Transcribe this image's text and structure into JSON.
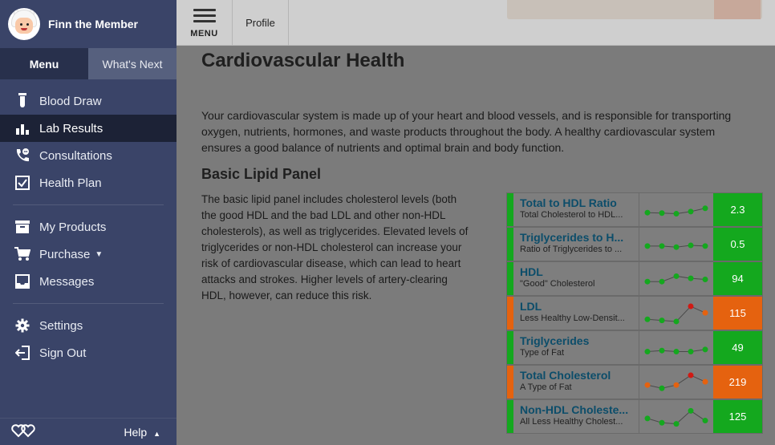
{
  "user": {
    "name": "Finn the Member"
  },
  "sidebar": {
    "tabs": [
      {
        "label": "Menu"
      },
      {
        "label": "What's Next"
      }
    ],
    "items": [
      {
        "label": "Blood Draw",
        "icon": "test-tube-icon"
      },
      {
        "label": "Lab Results",
        "icon": "bar-chart-icon",
        "active": true
      },
      {
        "label": "Consultations",
        "icon": "phone-chat-icon"
      },
      {
        "label": "Health Plan",
        "icon": "checkbox-icon"
      },
      {
        "label": "My Products",
        "icon": "archive-box-icon"
      },
      {
        "label": "Purchase",
        "icon": "shopping-cart-icon"
      },
      {
        "label": "Messages",
        "icon": "inbox-icon"
      },
      {
        "label": "Settings",
        "icon": "gear-icon"
      },
      {
        "label": "Sign Out",
        "icon": "sign-out-icon"
      }
    ],
    "footer": {
      "help_label": "Help"
    }
  },
  "topbar": {
    "menu_label": "MENU",
    "profile_label": "Profile"
  },
  "page": {
    "title": "Cardiovascular Health",
    "intro": "Your cardiovascular system is made up of your heart and blood vessels, and is responsible for transporting oxygen, nutrients, hormones, and waste products throughout the body. A healthy cardiovascular system ensures a good balance of nutrients and optimal brain and body function.",
    "section_title": "Basic Lipid Panel",
    "section_body": "The basic lipid panel includes cholesterol levels (both the good HDL and the bad LDL and other non-HDL cholesterols), as well as triglycerides. Elevated levels of triglycerides or non-HDL cholesterol can increase your risk of cardiovascular disease, which can lead to heart attacks and strokes. Higher levels of artery-clearing HDL, however, can reduce this risk."
  },
  "colors": {
    "green": "#14a81e",
    "orange": "#e5620f",
    "red": "#d11a14"
  },
  "labs": [
    {
      "name": "Total to HDL Ratio",
      "sub": "Total Cholesterol to HDL...",
      "value": "2.3",
      "status": "green",
      "trend": [
        {
          "v": 0.4,
          "c": "green"
        },
        {
          "v": 0.38,
          "c": "green"
        },
        {
          "v": 0.35,
          "c": "green"
        },
        {
          "v": 0.45,
          "c": "green"
        },
        {
          "v": 0.6,
          "c": "green"
        }
      ]
    },
    {
      "name": "Triglycerides to H...",
      "sub": "Ratio of Triglycerides to ...",
      "value": "0.5",
      "status": "green",
      "trend": [
        {
          "v": 0.45,
          "c": "green"
        },
        {
          "v": 0.45,
          "c": "green"
        },
        {
          "v": 0.4,
          "c": "green"
        },
        {
          "v": 0.48,
          "c": "green"
        },
        {
          "v": 0.45,
          "c": "green"
        }
      ]
    },
    {
      "name": "HDL",
      "sub": "\"Good\" Cholesterol",
      "value": "94",
      "status": "green",
      "trend": [
        {
          "v": 0.4,
          "c": "green"
        },
        {
          "v": 0.4,
          "c": "green"
        },
        {
          "v": 0.65,
          "c": "green"
        },
        {
          "v": 0.55,
          "c": "green"
        },
        {
          "v": 0.5,
          "c": "green"
        }
      ]
    },
    {
      "name": "LDL",
      "sub": "Less Healthy Low-Densit...",
      "value": "115",
      "status": "orange",
      "trend": [
        {
          "v": 0.25,
          "c": "green"
        },
        {
          "v": 0.2,
          "c": "green"
        },
        {
          "v": 0.15,
          "c": "green"
        },
        {
          "v": 0.85,
          "c": "red"
        },
        {
          "v": 0.55,
          "c": "orange"
        }
      ]
    },
    {
      "name": "Triglycerides",
      "sub": "Type of Fat",
      "value": "49",
      "status": "green",
      "trend": [
        {
          "v": 0.35,
          "c": "green"
        },
        {
          "v": 0.4,
          "c": "green"
        },
        {
          "v": 0.35,
          "c": "green"
        },
        {
          "v": 0.35,
          "c": "green"
        },
        {
          "v": 0.45,
          "c": "green"
        }
      ]
    },
    {
      "name": "Total Cholesterol",
      "sub": "A Type of Fat",
      "value": "219",
      "status": "orange",
      "trend": [
        {
          "v": 0.4,
          "c": "orange"
        },
        {
          "v": 0.25,
          "c": "green"
        },
        {
          "v": 0.4,
          "c": "orange"
        },
        {
          "v": 0.85,
          "c": "red"
        },
        {
          "v": 0.55,
          "c": "orange"
        }
      ]
    },
    {
      "name": "Non-HDL Choleste...",
      "sub": "All Less Healthy Cholest...",
      "value": "125",
      "status": "green",
      "trend": [
        {
          "v": 0.45,
          "c": "green"
        },
        {
          "v": 0.25,
          "c": "green"
        },
        {
          "v": 0.2,
          "c": "green"
        },
        {
          "v": 0.8,
          "c": "green"
        },
        {
          "v": 0.35,
          "c": "green"
        }
      ]
    }
  ]
}
